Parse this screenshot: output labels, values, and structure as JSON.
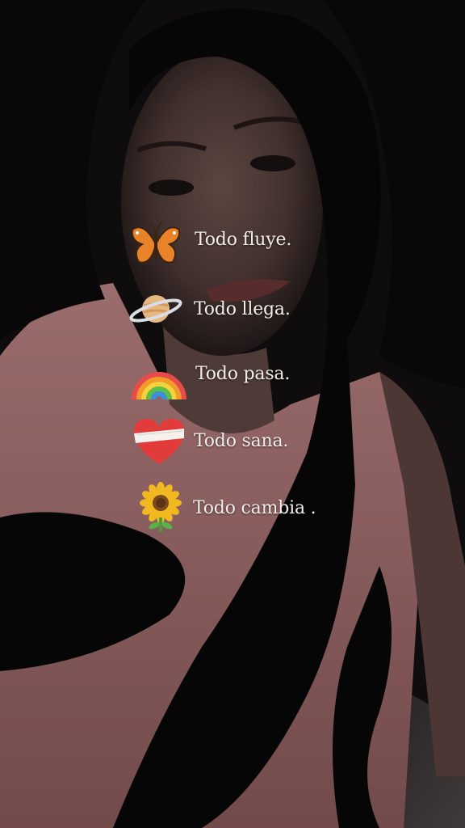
{
  "story": {
    "lines": [
      {
        "icon": "butterfly-icon",
        "text": "Todo fluye."
      },
      {
        "icon": "ringed-planet-icon",
        "text": "Todo llega."
      },
      {
        "icon": "rainbow-icon",
        "text": "Todo pasa."
      },
      {
        "icon": "bandaged-heart-icon",
        "text": "Todo sana."
      },
      {
        "icon": "sunflower-icon",
        "text": "Todo cambia ."
      }
    ]
  },
  "colors": {
    "text": "#f3eee9",
    "shirt": "#c98a89",
    "hair": "#0b090a",
    "skin": "#7a5c55"
  }
}
